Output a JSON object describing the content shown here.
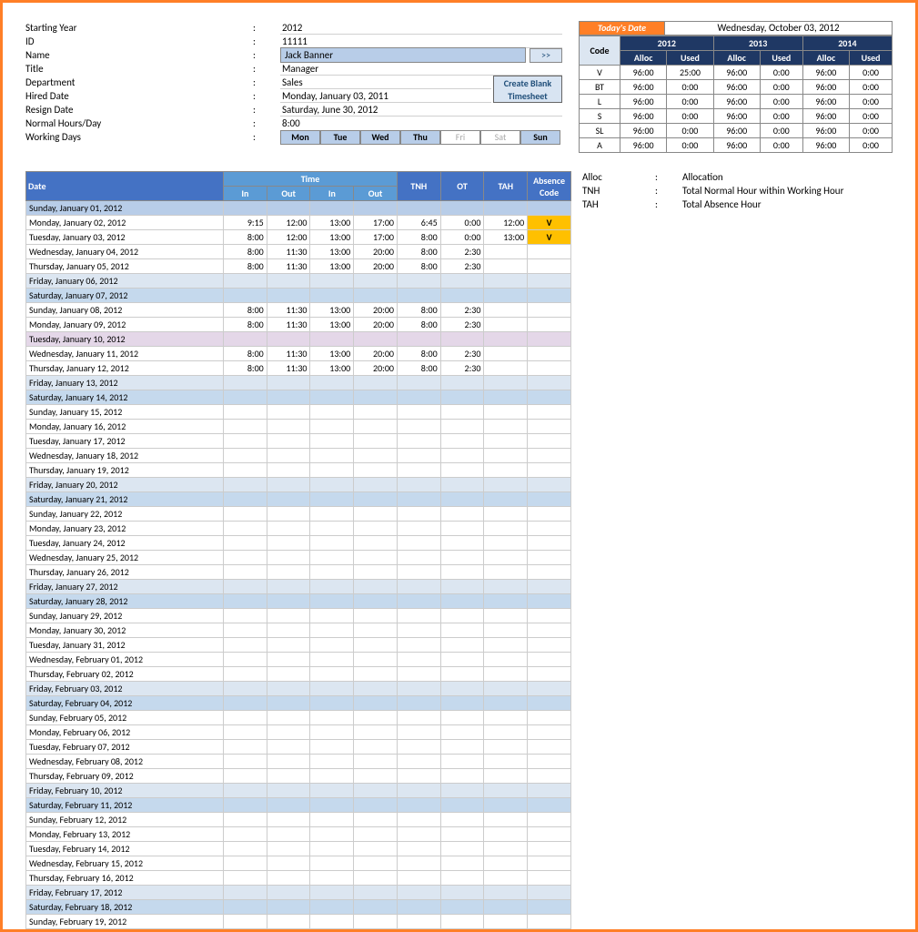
{
  "info": {
    "starting_year_label": "Starting Year",
    "starting_year": "2012",
    "id_label": "ID",
    "id": "11111",
    "name_label": "Name",
    "name": "Jack Banner",
    "arrow": ">>",
    "title_label": "Title",
    "title": "Manager",
    "dept_label": "Department",
    "dept": "Sales",
    "hired_label": "Hired Date",
    "hired": "Monday, January 03, 2011",
    "resign_label": "Resign Date",
    "resign": "Saturday, June 30, 2012",
    "hours_label": "Normal Hours/Day",
    "hours": "8:00",
    "working_label": "Working Days",
    "btn_create_l1": "Create Blank",
    "btn_create_l2": "Timesheet",
    "days": [
      "Mon",
      "Tue",
      "Wed",
      "Thu",
      "Fri",
      "Sat",
      "Sun"
    ],
    "days_active": [
      true,
      true,
      true,
      true,
      false,
      false,
      true
    ],
    "colon": ":"
  },
  "today": {
    "label": "Today's Date",
    "value": "Wednesday, October 03, 2012"
  },
  "alloc": {
    "code_label": "Code",
    "alloc_label": "Alloc",
    "used_label": "Used",
    "years": [
      "2012",
      "2013",
      "2014"
    ],
    "rows": [
      {
        "code": "V",
        "cells": [
          "96:00",
          "25:00",
          "96:00",
          "0:00",
          "96:00",
          "0:00"
        ]
      },
      {
        "code": "BT",
        "cells": [
          "96:00",
          "0:00",
          "96:00",
          "0:00",
          "96:00",
          "0:00"
        ]
      },
      {
        "code": "L",
        "cells": [
          "96:00",
          "0:00",
          "96:00",
          "0:00",
          "96:00",
          "0:00"
        ]
      },
      {
        "code": "S",
        "cells": [
          "96:00",
          "0:00",
          "96:00",
          "0:00",
          "96:00",
          "0:00"
        ]
      },
      {
        "code": "SL",
        "cells": [
          "96:00",
          "0:00",
          "96:00",
          "0:00",
          "96:00",
          "0:00"
        ]
      },
      {
        "code": "A",
        "cells": [
          "96:00",
          "0:00",
          "96:00",
          "0:00",
          "96:00",
          "0:00"
        ]
      }
    ]
  },
  "legend": [
    {
      "key": "Alloc",
      "val": "Allocation"
    },
    {
      "key": "TNH",
      "val": "Total Normal Hour within Working Hour"
    },
    {
      "key": "TAH",
      "val": "Total Absence Hour"
    }
  ],
  "ts_head": {
    "date": "Date",
    "time": "Time",
    "in": "In",
    "out": "Out",
    "tnh": "TNH",
    "ot": "OT",
    "tah": "TAH",
    "abs": "Absence Code"
  },
  "ts_rows": [
    {
      "d": "Sunday, January 01, 2012",
      "c": "sun"
    },
    {
      "d": "Monday, January 02, 2012",
      "v": [
        "9:15",
        "12:00",
        "13:00",
        "17:00",
        "6:45",
        "0:00",
        "12:00"
      ],
      "abs": "V"
    },
    {
      "d": "Tuesday, January 03, 2012",
      "v": [
        "8:00",
        "12:00",
        "13:00",
        "17:00",
        "8:00",
        "0:00",
        "13:00"
      ],
      "abs": "V"
    },
    {
      "d": "Wednesday, January 04, 2012",
      "v": [
        "8:00",
        "11:30",
        "13:00",
        "20:00",
        "8:00",
        "2:30",
        "",
        ""
      ]
    },
    {
      "d": "Thursday, January 05, 2012",
      "v": [
        "8:00",
        "11:30",
        "13:00",
        "20:00",
        "8:00",
        "2:30",
        "",
        ""
      ]
    },
    {
      "d": "Friday, January 06, 2012",
      "c": "fri"
    },
    {
      "d": "Saturday, January 07, 2012",
      "c": "sat"
    },
    {
      "d": "Sunday, January 08, 2012",
      "v": [
        "8:00",
        "11:30",
        "13:00",
        "20:00",
        "8:00",
        "2:30",
        "",
        ""
      ]
    },
    {
      "d": "Monday, January 09, 2012",
      "v": [
        "8:00",
        "11:30",
        "13:00",
        "20:00",
        "8:00",
        "2:30",
        "",
        ""
      ]
    },
    {
      "d": "Tuesday, January 10, 2012",
      "c": "tue-special"
    },
    {
      "d": "Wednesday, January 11, 2012",
      "v": [
        "8:00",
        "11:30",
        "13:00",
        "20:00",
        "8:00",
        "2:30",
        "",
        ""
      ]
    },
    {
      "d": "Thursday, January 12, 2012",
      "v": [
        "8:00",
        "11:30",
        "13:00",
        "20:00",
        "8:00",
        "2:30",
        "",
        ""
      ]
    },
    {
      "d": "Friday, January 13, 2012",
      "c": "fri"
    },
    {
      "d": "Saturday, January 14, 2012",
      "c": "sat"
    },
    {
      "d": "Sunday, January 15, 2012"
    },
    {
      "d": "Monday, January 16, 2012"
    },
    {
      "d": "Tuesday, January 17, 2012"
    },
    {
      "d": "Wednesday, January 18, 2012"
    },
    {
      "d": "Thursday, January 19, 2012"
    },
    {
      "d": "Friday, January 20, 2012",
      "c": "fri"
    },
    {
      "d": "Saturday, January 21, 2012",
      "c": "sat"
    },
    {
      "d": "Sunday, January 22, 2012"
    },
    {
      "d": "Monday, January 23, 2012"
    },
    {
      "d": "Tuesday, January 24, 2012"
    },
    {
      "d": "Wednesday, January 25, 2012"
    },
    {
      "d": "Thursday, January 26, 2012"
    },
    {
      "d": "Friday, January 27, 2012",
      "c": "fri"
    },
    {
      "d": "Saturday, January 28, 2012",
      "c": "sat"
    },
    {
      "d": "Sunday, January 29, 2012"
    },
    {
      "d": "Monday, January 30, 2012"
    },
    {
      "d": "Tuesday, January 31, 2012"
    },
    {
      "d": "Wednesday, February 01, 2012"
    },
    {
      "d": "Thursday, February 02, 2012"
    },
    {
      "d": "Friday, February 03, 2012",
      "c": "fri"
    },
    {
      "d": "Saturday, February 04, 2012",
      "c": "sat"
    },
    {
      "d": "Sunday, February 05, 2012"
    },
    {
      "d": "Monday, February 06, 2012"
    },
    {
      "d": "Tuesday, February 07, 2012"
    },
    {
      "d": "Wednesday, February 08, 2012"
    },
    {
      "d": "Thursday, February 09, 2012"
    },
    {
      "d": "Friday, February 10, 2012",
      "c": "fri"
    },
    {
      "d": "Saturday, February 11, 2012",
      "c": "sat"
    },
    {
      "d": "Sunday, February 12, 2012"
    },
    {
      "d": "Monday, February 13, 2012"
    },
    {
      "d": "Tuesday, February 14, 2012"
    },
    {
      "d": "Wednesday, February 15, 2012"
    },
    {
      "d": "Thursday, February 16, 2012"
    },
    {
      "d": "Friday, February 17, 2012",
      "c": "fri"
    },
    {
      "d": "Saturday, February 18, 2012",
      "c": "sat"
    },
    {
      "d": "Sunday, February 19, 2012"
    }
  ]
}
